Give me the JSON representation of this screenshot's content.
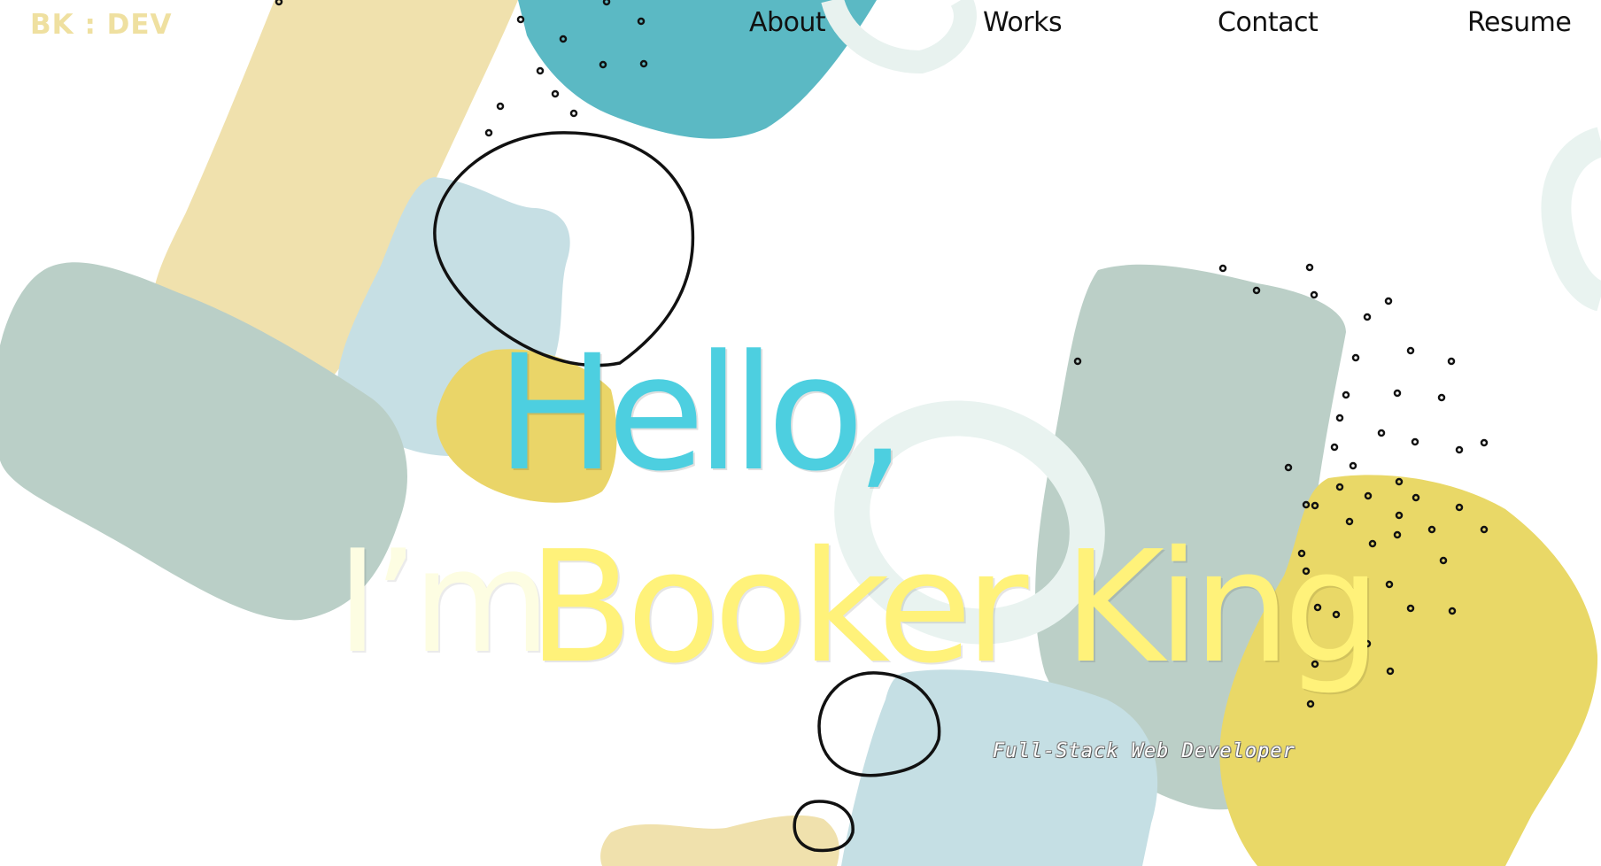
{
  "header": {
    "logo": "BK : DEV",
    "nav": [
      {
        "label": "About"
      },
      {
        "label": "Works"
      },
      {
        "label": "Contact"
      },
      {
        "label": "Resume"
      }
    ]
  },
  "hero": {
    "greeting": "Hello,",
    "intro": "I’m",
    "name": "Booker King",
    "role": "Full-Stack Web Developer"
  },
  "colors": {
    "logo": "#efe0a0",
    "greeting": "#4dcfe0",
    "name": "#fff27a",
    "teal_blob": "#5bb9c4",
    "sage_blob": "#bacfc7",
    "light_blue_blob": "#c5dfe3",
    "tan_blob": "#f1e2ac",
    "mustard_blob": "#e9d86a"
  }
}
